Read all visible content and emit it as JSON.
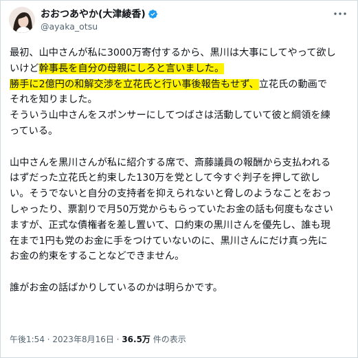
{
  "author": {
    "display_name": "おおつあやか(大津綾香)",
    "handle": "@ayaka_otsu",
    "avatar_icon": "avatar-photo-icon",
    "verified_icon": "verified-badge-icon",
    "verified_color": "#1d9bf0"
  },
  "more_icon": "more-horizontal-icon",
  "tweet": {
    "lines": [
      [
        {
          "t": "最初、山中さんが私に3000万寄付するから、黒川は大事にしてやって欲し"
        }
      ],
      [
        {
          "t": "いけど"
        },
        {
          "t": "幹事長を自分の母親にしろと言いました。",
          "hl": true
        }
      ],
      [
        {
          "t": "勝手に2億円の和解交渉を立花氏と行い事後報告もせず、",
          "hl": true
        },
        {
          "t": "立花氏の動画で"
        }
      ],
      [
        {
          "t": "それを知りました。"
        }
      ],
      [
        {
          "t": "そういう山中さんをスポンサーにしてつばさは活動していて彼と綱領を練"
        }
      ],
      [
        {
          "t": "っている。"
        }
      ],
      [],
      [
        {
          "t": "山中さんを黒川さんが私に紹介する席で、斎藤議員の報酬から支払われる"
        }
      ],
      [
        {
          "t": "はずだった立花氏と約束した130万を党として今すぐ判子を押して欲し"
        }
      ],
      [
        {
          "t": "い。そうでないと自分の支持者を抑えられないと脅しのようなことをおっ"
        }
      ],
      [
        {
          "t": "しゃったり、票割りで月50万党からもらっていたお金の話も何度もなさい"
        }
      ],
      [
        {
          "t": "ますが、正式な債権者を差し置いて、口約束の黒川さんを優先し、誰も現"
        }
      ],
      [
        {
          "t": "在まで1円も党のお金に手をつけていないのに、黒川さんにだけ真っ先に"
        }
      ],
      [
        {
          "t": "お金の約束をすることなどできません。"
        }
      ],
      [],
      [
        {
          "t": "誰がお金の話ばかりしているのかは明らかです。"
        }
      ]
    ],
    "highlight_color": "#fff200"
  },
  "meta": {
    "time": "午後1:54",
    "separator": " · ",
    "date": "2023年8月16日",
    "views_count": "36.5万",
    "views_label": " 件の表示"
  }
}
